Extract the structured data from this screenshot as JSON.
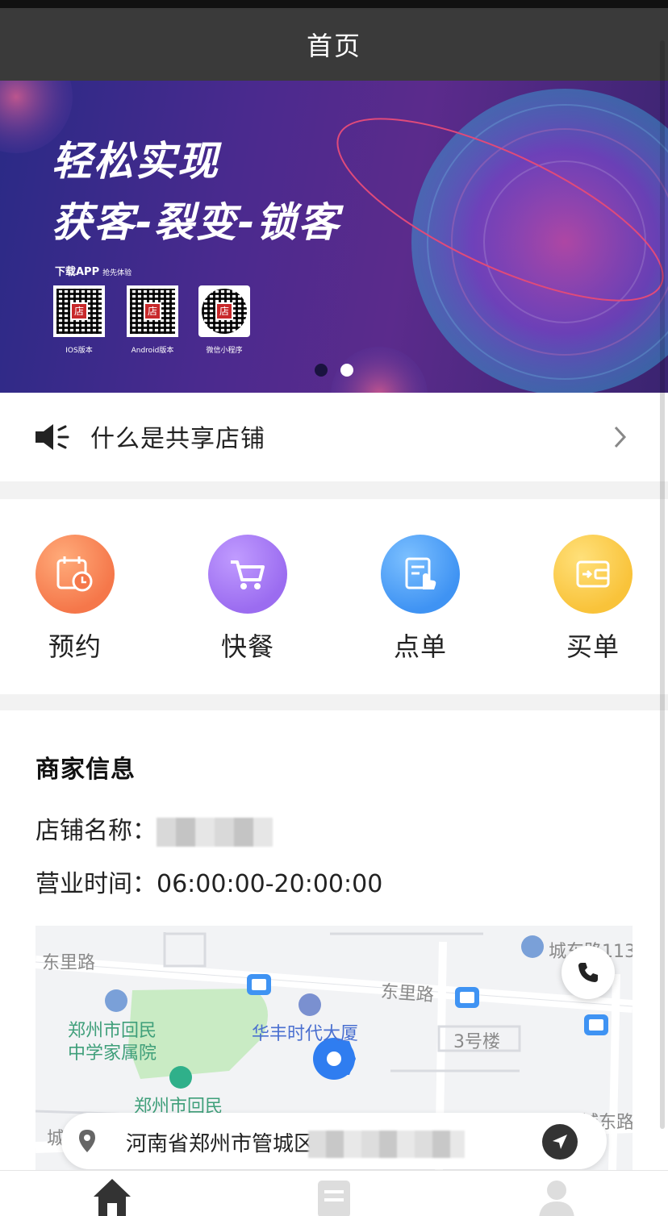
{
  "navbar": {
    "title": "首页"
  },
  "banner": {
    "headline_1": "轻松实现",
    "headline_2": "获客-裂变-锁客",
    "download_label": "下载APP",
    "download_sub": "抢先体验",
    "qrcodes": [
      {
        "label": "IOS版本"
      },
      {
        "label": "Android版本"
      },
      {
        "label": "微信小程序"
      }
    ],
    "page_indicator": {
      "count": 2,
      "active_index": 1
    }
  },
  "notice": {
    "text": "什么是共享店铺"
  },
  "menu": {
    "items": [
      {
        "label": "预约",
        "icon": "calendar-clock-icon",
        "color": "#f5774a"
      },
      {
        "label": "快餐",
        "icon": "cart-icon",
        "color": "#9b6cf0"
      },
      {
        "label": "点单",
        "icon": "order-edit-icon",
        "color": "#3f93f3"
      },
      {
        "label": "买单",
        "icon": "wallet-icon",
        "color": "#f9c33a"
      }
    ]
  },
  "merchant": {
    "section_title": "商家信息",
    "store_name_label": "店铺名称：",
    "hours_label": "营业时间：",
    "hours_value": "06:00:00-20:00:00",
    "map_labels": {
      "road_1": "东里路",
      "road_2": "东里路",
      "road_3": "城东路113",
      "road_4": "城东路",
      "poi_1": "郑州市回民",
      "poi_1b": "中学家属院",
      "poi_2": "华丰时代大厦",
      "poi_3": "3号楼",
      "poi_4": "郑州市回民",
      "poi_5": "城"
    },
    "address_prefix": "河南省郑州市管城区兴"
  },
  "tabbar": {
    "items": [
      {
        "icon": "home-icon"
      },
      {
        "icon": "orders-icon"
      },
      {
        "icon": "profile-icon"
      }
    ]
  }
}
